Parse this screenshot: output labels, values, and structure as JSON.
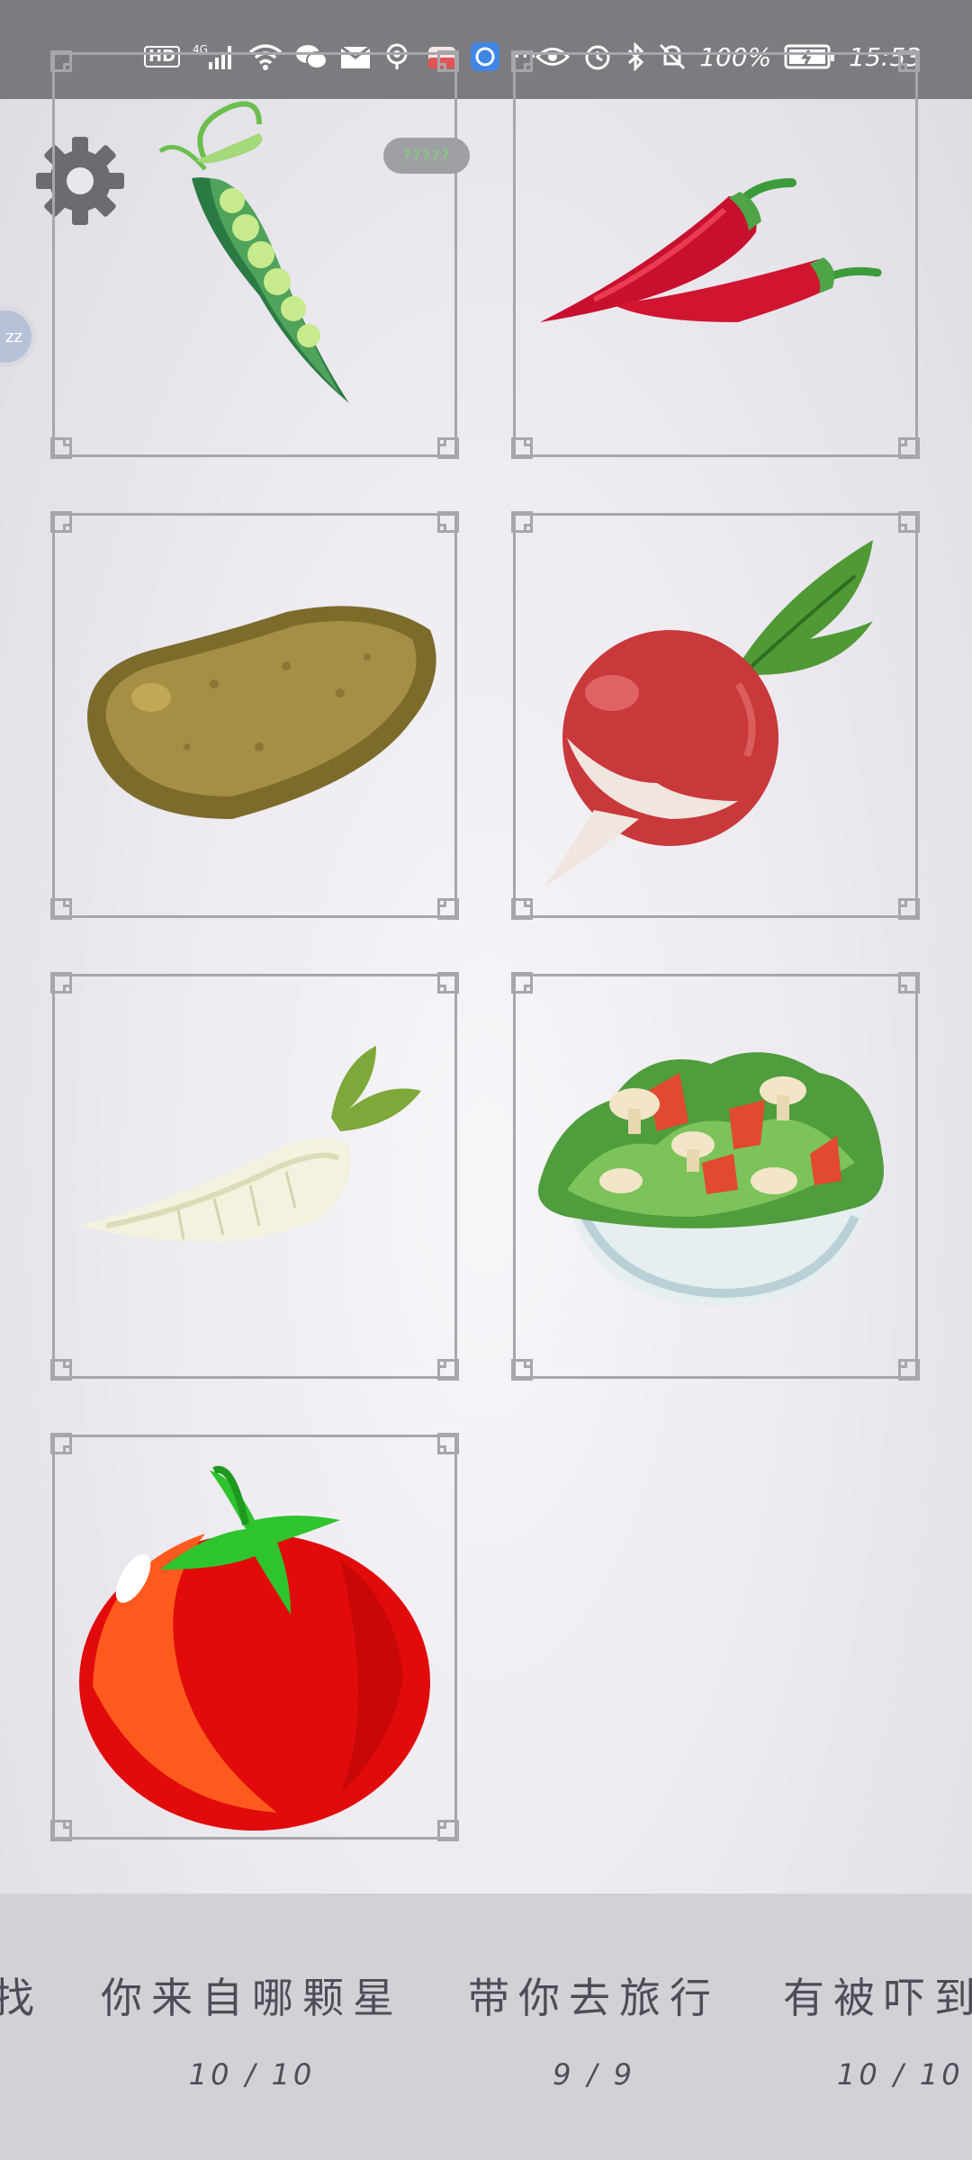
{
  "status_bar": {
    "left_icons": [
      "hd-icon",
      "signal-4g-icon",
      "wifi-icon",
      "wechat-icon",
      "mail-icon",
      "location-icon",
      "app-icon",
      "browser-icon",
      "more-dots-icon"
    ],
    "hd_label": "HD",
    "net_label": "4G",
    "more_label": "···",
    "battery_percent": "100%",
    "time": "15:53"
  },
  "badge": {
    "text": "?????"
  },
  "side_bubble": {
    "text": "zz"
  },
  "grid": {
    "cards": [
      {
        "name": "pea-pod"
      },
      {
        "name": "chili-peppers"
      },
      {
        "name": "potato"
      },
      {
        "name": "radish"
      },
      {
        "name": "daikon"
      },
      {
        "name": "salad-bowl"
      },
      {
        "name": "tomato"
      }
    ]
  },
  "bottom": {
    "songs": [
      {
        "title": "找",
        "count": ""
      },
      {
        "title": "你来自哪颗星",
        "count": "10 / 10"
      },
      {
        "title": "带你去旅行",
        "count": "9 / 9"
      },
      {
        "title": "有被吓到",
        "count": "10 / 10"
      }
    ]
  },
  "colors": {
    "status_bar_bg": "#7c7b80",
    "frame": "#a8a5ad",
    "bottom_bg": "#d3d0d8",
    "text_dark": "#4e4d55"
  }
}
